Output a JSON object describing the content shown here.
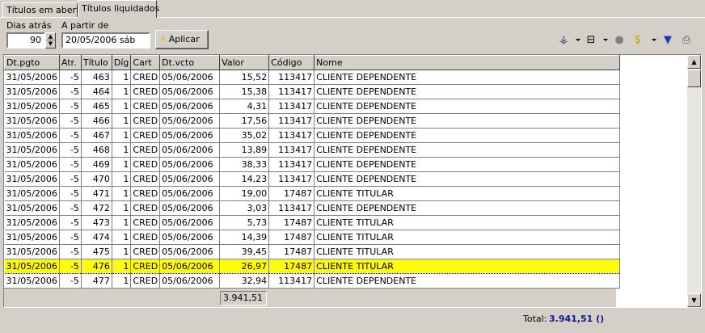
{
  "tabs": [
    {
      "label": "Títulos em aberto",
      "active": false
    },
    {
      "label": "Títulos liquidados",
      "active": true
    }
  ],
  "filter": {
    "dias_label": "Dias atrás",
    "dias_value": "90",
    "apartir_label": "A partir de",
    "apartir_value": "20/05/2006 sáb",
    "apply_label": "Aplicar"
  },
  "toolbar_icons": [
    "tree-filter-icon",
    "layout-icon",
    "circle-icon",
    "dollar-icon",
    "funnel-icon",
    "printer-icon"
  ],
  "grid": {
    "columns": [
      "Dt.pgto",
      "Atr.",
      "Título",
      "Díg",
      "Cart",
      "Dt.vcto",
      "Valor",
      "Código",
      "Nome"
    ],
    "rows": [
      [
        "31/05/2006",
        "-5",
        "463",
        "1",
        "CRED",
        "05/06/2006",
        "15,52",
        "113417",
        "CLIENTE DEPENDENTE"
      ],
      [
        "31/05/2006",
        "-5",
        "464",
        "1",
        "CRED",
        "05/06/2006",
        "15,38",
        "113417",
        "CLIENTE DEPENDENTE"
      ],
      [
        "31/05/2006",
        "-5",
        "465",
        "1",
        "CRED",
        "05/06/2006",
        "4,31",
        "113417",
        "CLIENTE DEPENDENTE"
      ],
      [
        "31/05/2006",
        "-5",
        "466",
        "1",
        "CRED",
        "05/06/2006",
        "17,56",
        "113417",
        "CLIENTE DEPENDENTE"
      ],
      [
        "31/05/2006",
        "-5",
        "467",
        "1",
        "CRED",
        "05/06/2006",
        "35,02",
        "113417",
        "CLIENTE DEPENDENTE"
      ],
      [
        "31/05/2006",
        "-5",
        "468",
        "1",
        "CRED",
        "05/06/2006",
        "13,89",
        "113417",
        "CLIENTE DEPENDENTE"
      ],
      [
        "31/05/2006",
        "-5",
        "469",
        "1",
        "CRED",
        "05/06/2006",
        "38,33",
        "113417",
        "CLIENTE DEPENDENTE"
      ],
      [
        "31/05/2006",
        "-5",
        "470",
        "1",
        "CRED",
        "05/06/2006",
        "14,23",
        "113417",
        "CLIENTE DEPENDENTE"
      ],
      [
        "31/05/2006",
        "-5",
        "471",
        "1",
        "CRED",
        "05/06/2006",
        "19,00",
        "17487",
        "CLIENTE TITULAR"
      ],
      [
        "31/05/2006",
        "-5",
        "472",
        "1",
        "CRED",
        "05/06/2006",
        "3,03",
        "113417",
        "CLIENTE DEPENDENTE"
      ],
      [
        "31/05/2006",
        "-5",
        "473",
        "1",
        "CRED",
        "05/06/2006",
        "5,73",
        "17487",
        "CLIENTE TITULAR"
      ],
      [
        "31/05/2006",
        "-5",
        "474",
        "1",
        "CRED",
        "05/06/2006",
        "14,39",
        "17487",
        "CLIENTE TITULAR"
      ],
      [
        "31/05/2006",
        "-5",
        "475",
        "1",
        "CRED",
        "05/06/2006",
        "39,45",
        "17487",
        "CLIENTE TITULAR"
      ],
      [
        "31/05/2006",
        "-5",
        "476",
        "1",
        "CRED",
        "05/06/2006",
        "26,97",
        "17487",
        "CLIENTE TITULAR"
      ],
      [
        "31/05/2006",
        "-5",
        "477",
        "1",
        "CRED",
        "05/06/2006",
        "32,94",
        "113417",
        "CLIENTE DEPENDENTE"
      ]
    ],
    "selected_row_index": 13,
    "sum": "3.941,51"
  },
  "status": {
    "total_label": "Total:",
    "total_value": "3.941,51 ()"
  },
  "colors": {
    "selection": "#ffff00",
    "total_value": "#0a1a8a",
    "window_bg": "#d4d0c8"
  }
}
